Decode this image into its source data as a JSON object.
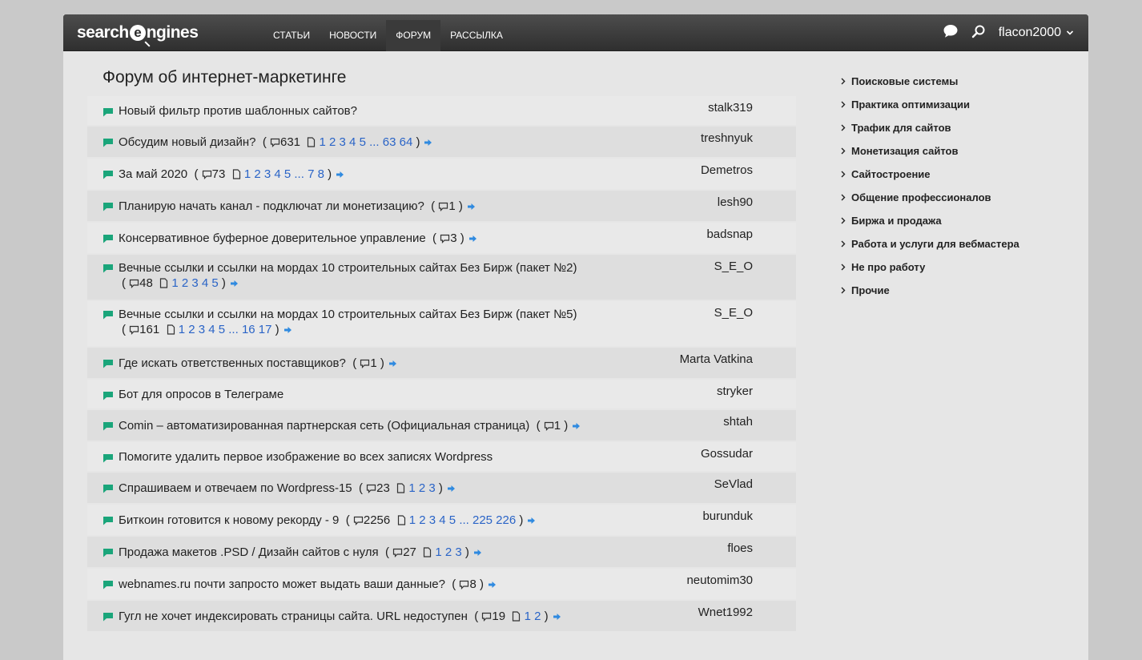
{
  "header": {
    "logo_left": "search",
    "logo_e": "e",
    "logo_right": "ngines",
    "nav": [
      "СТАТЬИ",
      "НОВОСТИ",
      "ФОРУМ",
      "РАССЫЛКА"
    ],
    "active_nav": "ФОРУМ",
    "username": "flacon2000"
  },
  "page_title": "Форум об интернет-маркетинге",
  "topics": [
    {
      "title": "Новый фильтр против шаблонных сайтов?",
      "author": "stalk319"
    },
    {
      "title": "Обсудим новый дизайн?",
      "replies": "631",
      "pages": "1 2 3 4 5 ... 63 64",
      "author": "treshnyuk"
    },
    {
      "title": "За май 2020",
      "replies": "73",
      "pages": "1 2 3 4 5 ... 7 8",
      "author": "Demetros"
    },
    {
      "title": "Планирую начать канал - подключат ли монетизацию?",
      "replies": "1",
      "author": "lesh90"
    },
    {
      "title": "Консервативное буферное доверительное управление",
      "replies": "3",
      "author": "badsnap"
    },
    {
      "title": "Вечные ссылки и ссылки на мордах 10 строительных сайтах Без Бирж (пакет №2)",
      "replies": "48",
      "pages": "1 2 3 4 5",
      "author": "S_E_O"
    },
    {
      "title": "Вечные ссылки и ссылки на мордах 10 строительных сайтах Без Бирж (пакет №5)",
      "replies": "161",
      "pages": "1 2 3 4 5 ... 16 17",
      "author": "S_E_O"
    },
    {
      "title": "Где искать ответственных поставщиков?",
      "replies": "1",
      "author": "Marta Vatkina"
    },
    {
      "title": "Бот для опросов в Телеграме",
      "author": "stryker"
    },
    {
      "title": "Comin – автоматизированная партнерская сеть (Официальная страница)",
      "replies": "1",
      "author": "shtah"
    },
    {
      "title": "Помогите удалить первое изображение во всех записях Wordpress",
      "author": "Gossudar"
    },
    {
      "title": "Спрашиваем и отвечаем по Wordpress-15",
      "replies": "23",
      "pages": "1 2 3",
      "author": "SeVlad"
    },
    {
      "title": "Биткоин готовится к новому рекорду - 9",
      "replies": "2256",
      "pages": "1 2 3 4 5 ... 225 226",
      "author": "burunduk"
    },
    {
      "title": "Продажа макетов .PSD / Дизайн сайтов с нуля",
      "replies": "27",
      "pages": "1 2 3",
      "author": "floes"
    },
    {
      "title": "webnames.ru почти запросто может выдать ваши данные?",
      "replies": "8",
      "author": "neutomim30"
    },
    {
      "title": "Гугл не хочет индексировать страницы сайта. URL недоступен",
      "replies": "19",
      "pages": "1 2",
      "author": "Wnet1992"
    }
  ],
  "sidebar": [
    "Поисковые системы",
    "Практика оптимизации",
    "Трафик для сайтов",
    "Монетизация сайтов",
    "Сайтостроение",
    "Общение профессионалов",
    "Биржа и продажа",
    "Работа и услуги для вебмастера",
    "Не про работу",
    "Прочие"
  ],
  "colors": {
    "bullet": "#1aa57a",
    "link": "#2a64c7",
    "arrow": "#2f8ae0",
    "topbar": "#3a3a3a"
  },
  "icons": {
    "chat": "chat-bubble-icon",
    "search": "search-icon",
    "replies": "comment-icon",
    "pages": "page-icon",
    "go_last": "arrow-right-icon",
    "chevron": "chevron-right-icon"
  }
}
